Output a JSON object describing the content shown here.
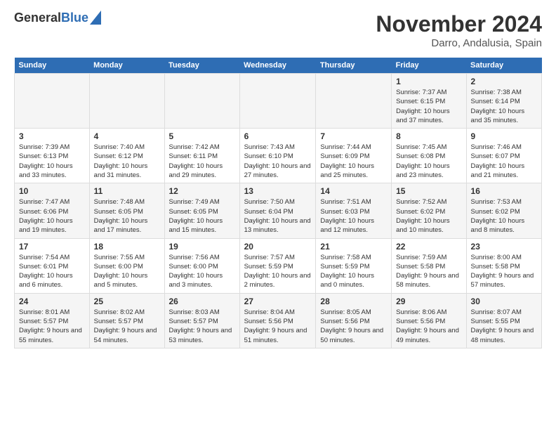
{
  "header": {
    "logo_general": "General",
    "logo_blue": "Blue",
    "month_title": "November 2024",
    "location": "Darro, Andalusia, Spain"
  },
  "days_of_week": [
    "Sunday",
    "Monday",
    "Tuesday",
    "Wednesday",
    "Thursday",
    "Friday",
    "Saturday"
  ],
  "weeks": [
    [
      {
        "day": "",
        "info": ""
      },
      {
        "day": "",
        "info": ""
      },
      {
        "day": "",
        "info": ""
      },
      {
        "day": "",
        "info": ""
      },
      {
        "day": "",
        "info": ""
      },
      {
        "day": "1",
        "info": "Sunrise: 7:37 AM\nSunset: 6:15 PM\nDaylight: 10 hours and 37 minutes."
      },
      {
        "day": "2",
        "info": "Sunrise: 7:38 AM\nSunset: 6:14 PM\nDaylight: 10 hours and 35 minutes."
      }
    ],
    [
      {
        "day": "3",
        "info": "Sunrise: 7:39 AM\nSunset: 6:13 PM\nDaylight: 10 hours and 33 minutes."
      },
      {
        "day": "4",
        "info": "Sunrise: 7:40 AM\nSunset: 6:12 PM\nDaylight: 10 hours and 31 minutes."
      },
      {
        "day": "5",
        "info": "Sunrise: 7:42 AM\nSunset: 6:11 PM\nDaylight: 10 hours and 29 minutes."
      },
      {
        "day": "6",
        "info": "Sunrise: 7:43 AM\nSunset: 6:10 PM\nDaylight: 10 hours and 27 minutes."
      },
      {
        "day": "7",
        "info": "Sunrise: 7:44 AM\nSunset: 6:09 PM\nDaylight: 10 hours and 25 minutes."
      },
      {
        "day": "8",
        "info": "Sunrise: 7:45 AM\nSunset: 6:08 PM\nDaylight: 10 hours and 23 minutes."
      },
      {
        "day": "9",
        "info": "Sunrise: 7:46 AM\nSunset: 6:07 PM\nDaylight: 10 hours and 21 minutes."
      }
    ],
    [
      {
        "day": "10",
        "info": "Sunrise: 7:47 AM\nSunset: 6:06 PM\nDaylight: 10 hours and 19 minutes."
      },
      {
        "day": "11",
        "info": "Sunrise: 7:48 AM\nSunset: 6:05 PM\nDaylight: 10 hours and 17 minutes."
      },
      {
        "day": "12",
        "info": "Sunrise: 7:49 AM\nSunset: 6:05 PM\nDaylight: 10 hours and 15 minutes."
      },
      {
        "day": "13",
        "info": "Sunrise: 7:50 AM\nSunset: 6:04 PM\nDaylight: 10 hours and 13 minutes."
      },
      {
        "day": "14",
        "info": "Sunrise: 7:51 AM\nSunset: 6:03 PM\nDaylight: 10 hours and 12 minutes."
      },
      {
        "day": "15",
        "info": "Sunrise: 7:52 AM\nSunset: 6:02 PM\nDaylight: 10 hours and 10 minutes."
      },
      {
        "day": "16",
        "info": "Sunrise: 7:53 AM\nSunset: 6:02 PM\nDaylight: 10 hours and 8 minutes."
      }
    ],
    [
      {
        "day": "17",
        "info": "Sunrise: 7:54 AM\nSunset: 6:01 PM\nDaylight: 10 hours and 6 minutes."
      },
      {
        "day": "18",
        "info": "Sunrise: 7:55 AM\nSunset: 6:00 PM\nDaylight: 10 hours and 5 minutes."
      },
      {
        "day": "19",
        "info": "Sunrise: 7:56 AM\nSunset: 6:00 PM\nDaylight: 10 hours and 3 minutes."
      },
      {
        "day": "20",
        "info": "Sunrise: 7:57 AM\nSunset: 5:59 PM\nDaylight: 10 hours and 2 minutes."
      },
      {
        "day": "21",
        "info": "Sunrise: 7:58 AM\nSunset: 5:59 PM\nDaylight: 10 hours and 0 minutes."
      },
      {
        "day": "22",
        "info": "Sunrise: 7:59 AM\nSunset: 5:58 PM\nDaylight: 9 hours and 58 minutes."
      },
      {
        "day": "23",
        "info": "Sunrise: 8:00 AM\nSunset: 5:58 PM\nDaylight: 9 hours and 57 minutes."
      }
    ],
    [
      {
        "day": "24",
        "info": "Sunrise: 8:01 AM\nSunset: 5:57 PM\nDaylight: 9 hours and 55 minutes."
      },
      {
        "day": "25",
        "info": "Sunrise: 8:02 AM\nSunset: 5:57 PM\nDaylight: 9 hours and 54 minutes."
      },
      {
        "day": "26",
        "info": "Sunrise: 8:03 AM\nSunset: 5:57 PM\nDaylight: 9 hours and 53 minutes."
      },
      {
        "day": "27",
        "info": "Sunrise: 8:04 AM\nSunset: 5:56 PM\nDaylight: 9 hours and 51 minutes."
      },
      {
        "day": "28",
        "info": "Sunrise: 8:05 AM\nSunset: 5:56 PM\nDaylight: 9 hours and 50 minutes."
      },
      {
        "day": "29",
        "info": "Sunrise: 8:06 AM\nSunset: 5:56 PM\nDaylight: 9 hours and 49 minutes."
      },
      {
        "day": "30",
        "info": "Sunrise: 8:07 AM\nSunset: 5:55 PM\nDaylight: 9 hours and 48 minutes."
      }
    ]
  ]
}
